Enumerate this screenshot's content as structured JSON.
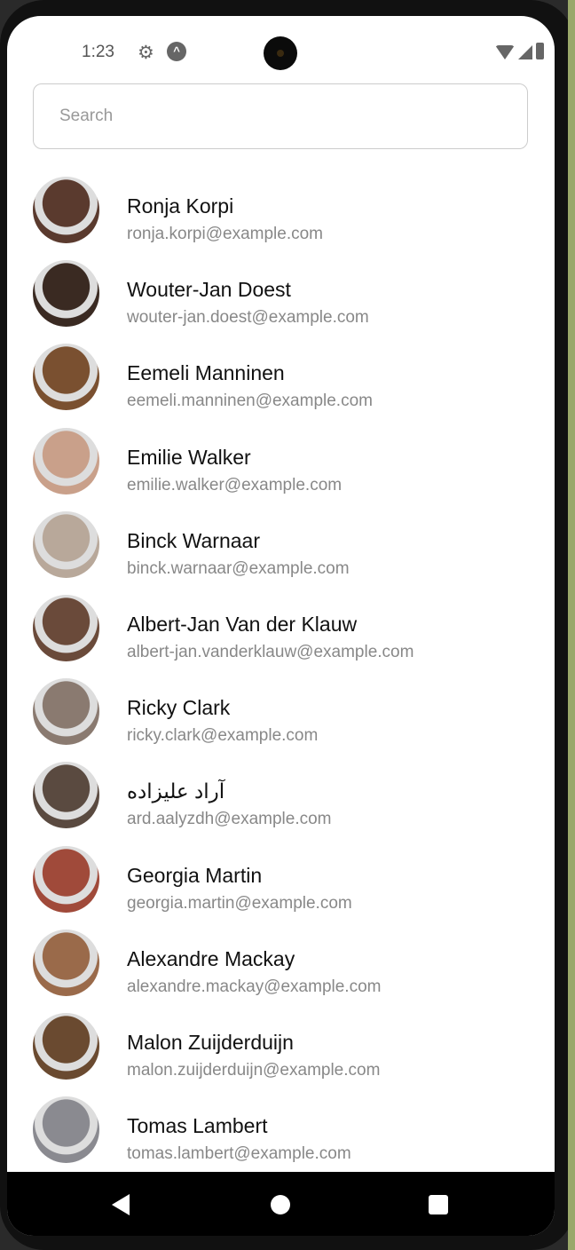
{
  "status_bar": {
    "time": "1:23",
    "icons": [
      "gear-icon",
      "expo-icon",
      "wifi-icon",
      "signal-icon",
      "battery-icon"
    ]
  },
  "search": {
    "placeholder": "Search",
    "value": ""
  },
  "contacts": [
    {
      "name": "Ronja Korpi",
      "email": "ronja.korpi@example.com",
      "avatar_color": "#5a3a2e"
    },
    {
      "name": "Wouter-Jan Doest",
      "email": "wouter-jan.doest@example.com",
      "avatar_color": "#3a2a22"
    },
    {
      "name": "Eemeli Manninen",
      "email": "eemeli.manninen@example.com",
      "avatar_color": "#7a5030"
    },
    {
      "name": "Emilie Walker",
      "email": "emilie.walker@example.com",
      "avatar_color": "#c9a08a"
    },
    {
      "name": "Binck Warnaar",
      "email": "binck.warnaar@example.com",
      "avatar_color": "#b8a89a"
    },
    {
      "name": "Albert-Jan Van der Klauw",
      "email": "albert-jan.vanderklauw@example.com",
      "avatar_color": "#6a4a3a"
    },
    {
      "name": "Ricky Clark",
      "email": "ricky.clark@example.com",
      "avatar_color": "#8a7a70"
    },
    {
      "name": "آراد علیزاده",
      "email": "ard.aalyzdh@example.com",
      "avatar_color": "#5a4a40"
    },
    {
      "name": "Georgia Martin",
      "email": "georgia.martin@example.com",
      "avatar_color": "#a04a3a"
    },
    {
      "name": "Alexandre Mackay",
      "email": "alexandre.mackay@example.com",
      "avatar_color": "#9a6a4a"
    },
    {
      "name": "Malon Zuijderduijn",
      "email": "malon.zuijderduijn@example.com",
      "avatar_color": "#6a4a30"
    },
    {
      "name": "Tomas Lambert",
      "email": "tomas.lambert@example.com",
      "avatar_color": "#8a8a90"
    }
  ]
}
